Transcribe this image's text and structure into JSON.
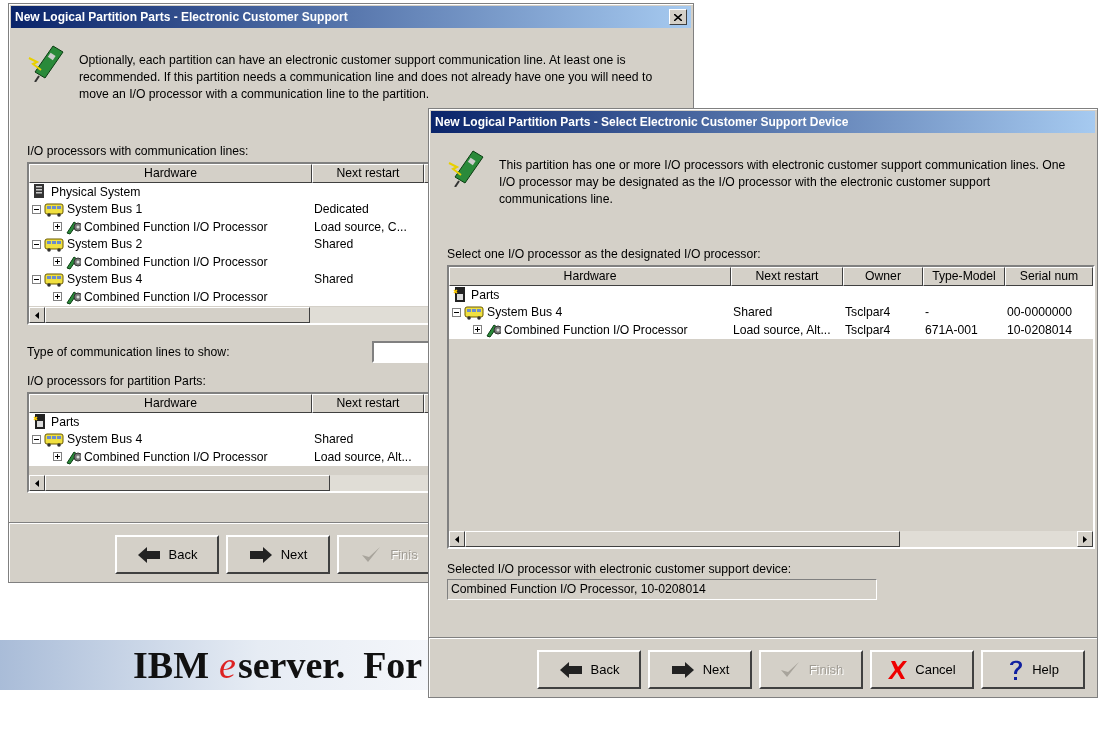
{
  "slide": {
    "footer": {
      "brand": "IBM",
      "logo_letter": "e",
      "text": "server.",
      "text_2": "For"
    }
  },
  "windows": [
    {
      "title": "New Logical Partition Parts - Electronic Customer Support",
      "close_button": true,
      "message": "Optionally, each partition can have an electronic customer support communication line.  At least one is recommended.  If this partition needs a communication line and does not already have one you will need to move an I/O processor with a communication line to the partition.",
      "sections": [
        {
          "kind": "tree",
          "label": "I/O processors with communication lines:",
          "columns": [
            "Hardware",
            "Next restart"
          ],
          "nodes": [
            {
              "label": "Physical System",
              "kind": "system",
              "children": [
                {
                  "label": "System Bus 1",
                  "kind": "bus",
                  "expanded": true,
                  "cells": [
                    "Dedicated"
                  ],
                  "children": [
                    {
                      "label": "Combined Function I/O Processor",
                      "kind": "processor",
                      "expanded": false,
                      "cells": [
                        "Load source, C..."
                      ]
                    }
                  ]
                },
                {
                  "label": "System Bus 2",
                  "kind": "bus",
                  "expanded": true,
                  "cells": [
                    "Shared"
                  ],
                  "children": [
                    {
                      "label": "Combined Function I/O Processor",
                      "kind": "processor",
                      "expanded": false
                    }
                  ]
                },
                {
                  "label": "System Bus 4",
                  "kind": "bus",
                  "expanded": true,
                  "cells": [
                    "Shared"
                  ],
                  "children": [
                    {
                      "label": "Combined Function I/O Processor",
                      "kind": "processor",
                      "expanded": false
                    }
                  ]
                }
              ]
            }
          ]
        },
        {
          "kind": "dropdown",
          "label": "Type of communication lines to show:"
        },
        {
          "kind": "tree",
          "label": "I/O processors for partition Parts:",
          "columns": [
            "Hardware",
            "Next restart"
          ],
          "nodes": [
            {
              "label": "Parts",
              "kind": "parts",
              "children": [
                {
                  "label": "System Bus 4",
                  "kind": "bus",
                  "expanded": true,
                  "cells": [
                    "Shared"
                  ],
                  "children": [
                    {
                      "label": "Combined Function I/O Processor",
                      "kind": "processor",
                      "expanded": false,
                      "cells": [
                        "Load source, Alt..."
                      ]
                    }
                  ]
                }
              ]
            }
          ]
        }
      ],
      "buttons": [
        {
          "kind": "back",
          "label": "Back",
          "disabled": false
        },
        {
          "kind": "next",
          "label": "Next",
          "disabled": false
        },
        {
          "kind": "finish",
          "label": "Finis",
          "disabled": true
        }
      ]
    },
    {
      "title": "New Logical Partition Parts - Select Electronic Customer Support Device",
      "close_button": false,
      "message": "This partition has one or more I/O processors with electronic customer support communication lines.  One I/O processor may be designated as the I/O processor with the electronic customer support communications line.",
      "sections": [
        {
          "kind": "tree",
          "label": "Select one I/O processor as the designated I/O processor:",
          "columns": [
            "Hardware",
            "Next restart",
            "Owner",
            "Type-Model",
            "Serial num"
          ],
          "nodes": [
            {
              "label": "Parts",
              "kind": "parts",
              "children": [
                {
                  "label": "System Bus 4",
                  "kind": "bus",
                  "expanded": true,
                  "cells": [
                    "Shared",
                    "Tsclpar4",
                    "-",
                    "00-0000000"
                  ],
                  "children": [
                    {
                      "label": "Combined Function I/O Processor",
                      "kind": "processor",
                      "expanded": false,
                      "cells": [
                        "Load source, Alt...",
                        "Tsclpar4",
                        "671A-001",
                        "10-0208014"
                      ]
                    }
                  ]
                }
              ]
            }
          ]
        },
        {
          "kind": "field",
          "label": "Selected I/O processor with electronic customer support device:",
          "value": "Combined Function I/O Processor, 10-0208014"
        }
      ],
      "buttons": [
        {
          "kind": "back",
          "label": "Back",
          "disabled": false
        },
        {
          "kind": "next",
          "label": "Next",
          "disabled": false
        },
        {
          "kind": "finish",
          "label": "Finish",
          "disabled": true
        },
        {
          "kind": "cancel",
          "label": "Cancel",
          "disabled": false
        },
        {
          "kind": "help",
          "label": "Help",
          "disabled": false
        }
      ]
    }
  ]
}
